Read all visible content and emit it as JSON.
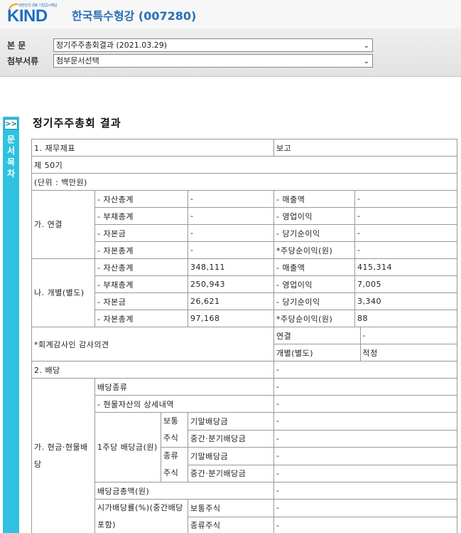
{
  "header": {
    "logo_tagline": "대한민국 대표 기업공시채널",
    "logo_word": "KIND",
    "company": "한국특수형강 (007280)"
  },
  "docbar": {
    "main_label": "본 문",
    "main_value": "정기주주총회결과 (2021.03.29)",
    "attach_label": "첨부서류",
    "attach_value": "첨부문서선택"
  },
  "sidebar": {
    "button": ">>",
    "label": "문서목차"
  },
  "title": "정기주주총회 결과",
  "report": {
    "r1": {
      "label": "1. 재무제표",
      "value": "보고"
    },
    "period": "제 50기",
    "unit": "(단위 : 백만원)",
    "consolidated": {
      "label": "가. 연결",
      "rows": [
        {
          "item1": "- 자산총계",
          "val1": "-",
          "item2": "- 매출액",
          "val2": "-"
        },
        {
          "item1": "- 부채총계",
          "val1": "-",
          "item2": "- 영업이익",
          "val2": "-"
        },
        {
          "item1": "- 자본금",
          "val1": "-",
          "item2": "- 당기순이익",
          "val2": "-"
        },
        {
          "item1": "- 자본총계",
          "val1": "-",
          "item2": "*주당순이익(원)",
          "val2": "-"
        }
      ]
    },
    "separate": {
      "label": "나. 개별(별도)",
      "rows": [
        {
          "item1": "- 자산총계",
          "val1": "348,111",
          "item2": "- 매출액",
          "val2": "415,314"
        },
        {
          "item1": "- 부채총계",
          "val1": "250,943",
          "item2": "- 영업이익",
          "val2": "7,005"
        },
        {
          "item1": "- 자본금",
          "val1": "26,621",
          "item2": "- 당기순이익",
          "val2": "3,340"
        },
        {
          "item1": "- 자본총계",
          "val1": "97,168",
          "item2": "*주당순이익(원)",
          "val2": "88"
        }
      ]
    },
    "audit": {
      "label": "*회계감사인 감사의견",
      "consolidated_label": "연결",
      "consolidated_value": "-",
      "separate_label": "개별(별도)",
      "separate_value": "적정"
    },
    "dividend": {
      "label": "2. 배당",
      "value": "-",
      "cash_label": "가. 현금·현물배당",
      "kind_label": "배당종류",
      "kind_value": "-",
      "inkind_label": "- 현물자산의 상세내역",
      "inkind_value": "-",
      "per_share_label": "1주당 배당금(원)",
      "common_label": "보통주식",
      "pref_label": "종류주식",
      "year_end_label": "기말배당금",
      "interim_label": "중간·분기배당금",
      "common_year_end": "-",
      "common_interim": "-",
      "pref_year_end": "-",
      "pref_interim": "-",
      "total_label": "배당금총액(원)",
      "total_value": "-",
      "yield_label": "시가배당률(%)(중간배당 포함)",
      "yield_common_label": "보통주식",
      "yield_common_value": "-",
      "yield_pref_label": "종류주식",
      "yield_pref_value": "-"
    }
  }
}
